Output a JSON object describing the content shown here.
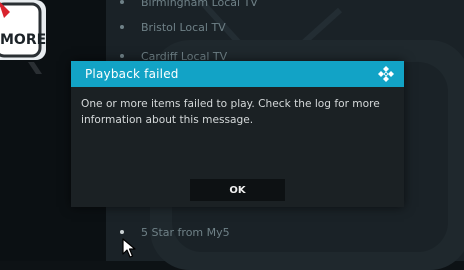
{
  "background": {
    "channels": [
      {
        "label": "Birmingham Local TV"
      },
      {
        "label": "Bristol Local TV"
      },
      {
        "label": "Cardiff Local TV"
      },
      {
        "label": "5 Star from My5"
      }
    ],
    "promo_text": "MORE"
  },
  "dialog": {
    "title": "Playback failed",
    "message": "One or more items failed to play. Check the log for more information about this message.",
    "ok_label": "OK",
    "logo_icon": "kodi-logo-icon"
  },
  "colors": {
    "header": "#12a3c6",
    "dialog_bg": "#1b2124",
    "button_bg": "#0d1113"
  }
}
